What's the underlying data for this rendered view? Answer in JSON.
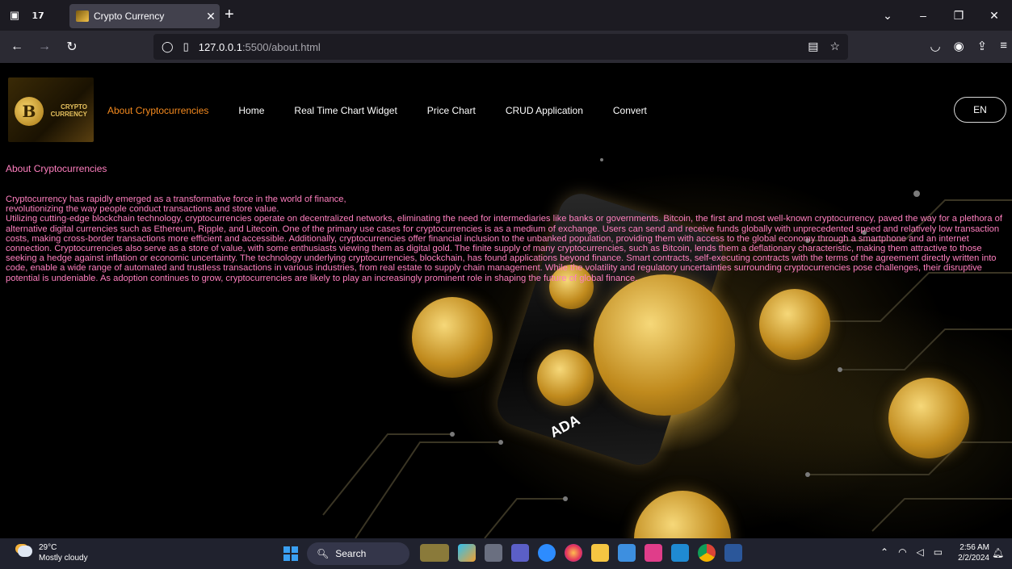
{
  "browser": {
    "tab_title": "Crypto Currency",
    "url_host": "127.0.0.1",
    "url_path": ":5500/about.html"
  },
  "site": {
    "logo_text": "CRYPTO CURRENCY",
    "nav": [
      {
        "label": "About Cryptocurrencies"
      },
      {
        "label": "Home"
      },
      {
        "label": "Real Time Chart Widget"
      },
      {
        "label": "Price Chart"
      },
      {
        "label": "CRUD Application"
      },
      {
        "label": "Convert"
      }
    ],
    "lang_button": "EN",
    "accent_color": "#f58a1e",
    "text_color": "#ff7fbf"
  },
  "content": {
    "heading": "About Cryptocurrencies",
    "line1": "Cryptocurrency has rapidly emerged as a transformative force in the world of finance,",
    "line2": "revolutionizing the way people conduct transactions and store value.",
    "paragraph": "Utilizing cutting-edge blockchain technology, cryptocurrencies operate on decentralized networks, eliminating the need for intermediaries like banks or governments. Bitcoin, the first and most well-known cryptocurrency, paved the way for a plethora of alternative digital currencies such as Ethereum, Ripple, and Litecoin. One of the primary use cases for cryptocurrencies is as a medium of exchange. Users can send and receive funds globally with unprecedented speed and relatively low transaction costs, making cross-border transactions more efficient and accessible. Additionally, cryptocurrencies offer financial inclusion to the unbanked population, providing them with access to the global economy through a smartphone and an internet connection. Cryptocurrencies also serve as a store of value, with some enthusiasts viewing them as digital gold. The finite supply of many cryptocurrencies, such as Bitcoin, lends them a deflationary characteristic, making them attractive to those seeking a hedge against inflation or economic uncertainty. The technology underlying cryptocurrencies, blockchain, has found applications beyond finance. Smart contracts, self-executing contracts with the terms of the agreement directly written into code, enable a wide range of automated and trustless transactions in various industries, from real estate to supply chain management. While the volatility and regulatory uncertainties surrounding cryptocurrencies pose challenges, their disruptive potential is undeniable. As adoption continues to grow, cryptocurrencies are likely to play an increasingly prominent role in shaping the future of global finance."
  },
  "hero_phone_text": "ADA",
  "taskbar": {
    "temperature": "29°C",
    "weather": "Mostly cloudy",
    "search_label": "Search",
    "time": "2:56 AM",
    "date": "2/2/2024"
  }
}
